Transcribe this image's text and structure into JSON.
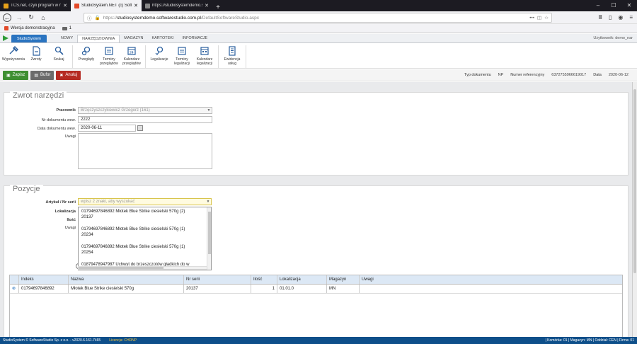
{
  "browser": {
    "tabs": [
      {
        "title": "TCS.net, czyli program w narzę",
        "color": "#e8a21a",
        "active": false
      },
      {
        "title": "StudioSystem.NET (c) Software",
        "color": "#e34a2a",
        "active": true
      },
      {
        "title": "https://studiosystemdemo.softwa",
        "color": "#888888",
        "active": false
      }
    ],
    "url_prefix": "https://",
    "url_domain": "studiosystemdemo.softwarestudio.com.pl",
    "url_path": "/DefaultSoftwareStudio.aspx",
    "bookmarks": [
      {
        "label": "Wersja demonstracyjna"
      },
      {
        "label": "1"
      }
    ]
  },
  "app": {
    "brand": "StudioSystem",
    "menu_tabs": [
      "NOWY",
      "NARZĘDZIOWNIA",
      "MAGAZYN",
      "KARTOTEKI",
      "INFORMACJE"
    ],
    "active_tab_index": 1,
    "user_label": "Użytkownik: demo_nar",
    "ribbon": [
      {
        "label": "Wypożyczenia",
        "icon": "tool-lend-icon"
      },
      {
        "label": "Zwroty",
        "icon": "document-return-icon"
      },
      {
        "label": "Szukaj",
        "icon": "search-tool-icon"
      },
      {
        "label": "Przeglądy",
        "icon": "gears-icon"
      },
      {
        "label": "Terminy przeglądów",
        "icon": "calendar-list-icon"
      },
      {
        "label": "Kalendarz przeglądów",
        "icon": "calendar-icon"
      },
      {
        "label": "Legalizacje",
        "icon": "gear-check-icon"
      },
      {
        "label": "Terminy legalizacji",
        "icon": "calendar-list-icon"
      },
      {
        "label": "Kalendarz legalizacji",
        "icon": "calendar-icon"
      },
      {
        "label": "Ewidencja usług",
        "icon": "register-icon"
      }
    ],
    "actions": {
      "save": "Zapisz",
      "buffer": "Bufor",
      "cancel": "Anuluj"
    },
    "doc_info": {
      "type_label": "Typ dokumentu",
      "type_value": "NP",
      "ref_label": "Numer referencyjny",
      "ref_value": "6372755966619017",
      "date_label": "Data",
      "date_value": "2020-06-12"
    }
  },
  "form": {
    "title": "Zwrot narzędzi",
    "employee_label": "Pracownik",
    "employee_value": "Brzęczyszczykiewicz Grzegorz (161)",
    "ext_doc_no_label": "Nr dokumentu wew.",
    "ext_doc_no_value": "2222",
    "ext_doc_date_label": "Data dokumentu wew.",
    "ext_doc_date_value": "2020-06-11",
    "notes_label": "Uwagi",
    "notes_value": ""
  },
  "positions": {
    "title": "Pozycje",
    "article_label": "Artykuł / Nr serii",
    "article_placeholder": "wpisz 2 znaki, aby wyszukać",
    "location_label": "Lokalizacja",
    "qty_label": "Ilość",
    "notes_label": "Uwagi",
    "suggestions": [
      {
        "line1": "01794697846892 Młotek Blue Strike ciesielski 570g (2)",
        "line2": "20137"
      },
      {
        "line1": "01794697846892 Młotek Blue Strike ciesielski 570g (1)",
        "line2": "20234"
      },
      {
        "line1": "01794697846892 Młotek Blue Strike ciesielski 570g (1)",
        "line2": "20254"
      },
      {
        "line1": "01879478947987 Uchwyt do brzeszczotów gładkich do w",
        "line2": ""
      }
    ],
    "columns": [
      "Indeks",
      "Nazwa",
      "Nr serii",
      "Ilość",
      "Lokalizacja",
      "Magazyn",
      "Uwagi"
    ],
    "rows": [
      {
        "index": "01794697846892",
        "name": "Młotek Blue Strike ciesielski 570g",
        "serial": "20137",
        "qty": "1",
        "location": "01.01.0",
        "warehouse": "MN",
        "notes": ""
      }
    ]
  },
  "status": {
    "left": "StudioSystem © SoftwareStudio Sp. z o.o. - v2020.6.161.7465",
    "license": "Licencja: CHRNP",
    "right": "| Komórka: 01 | Magazyn: MN | Oddział: CEN | Firma: 01"
  }
}
